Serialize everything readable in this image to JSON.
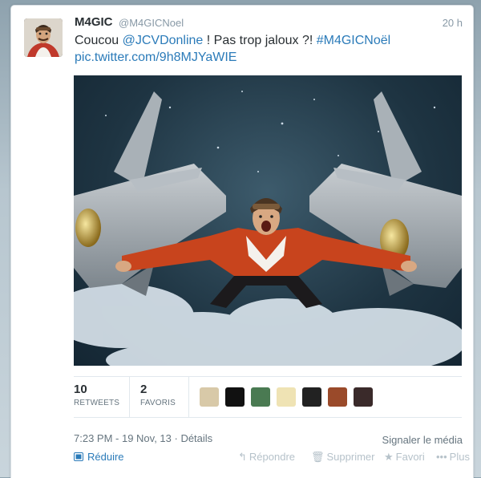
{
  "tweet": {
    "name": "M4GIC",
    "handle": "@M4GICNoel",
    "time": "20 h",
    "text_before": "Coucou ",
    "mention": "@JCVDonline",
    "text_middle": " ! Pas trop jaloux ?! ",
    "hashtag": "#M4GICNoël",
    "pic_link": "pic.twitter.com/9h8MJYaWIE"
  },
  "stats": {
    "retweets_count": "10",
    "retweets_label": "RETWEETS",
    "favorites_count": "2",
    "favorites_label": "FAVORIS"
  },
  "favoriters": [
    {
      "name": "favoriter-avatar-1",
      "color": "#d8c9a8"
    },
    {
      "name": "favoriter-avatar-2",
      "color": "#111111"
    },
    {
      "name": "favoriter-avatar-3",
      "color": "#4a7a52"
    },
    {
      "name": "favoriter-avatar-4",
      "color": "#efe3b4"
    },
    {
      "name": "favoriter-avatar-5",
      "color": "#222222"
    },
    {
      "name": "favoriter-avatar-6",
      "color": "#9a4a2a"
    },
    {
      "name": "favoriter-avatar-7",
      "color": "#3a2a2a"
    }
  ],
  "meta": {
    "timestamp": "7:23 PM - 19 Nov, 13",
    "separator": " · ",
    "details": "Détails",
    "report_media": "Signaler le média"
  },
  "actions": {
    "collapse": "Réduire",
    "reply": "Répondre",
    "delete": "Supprimer",
    "favorite": "Favori",
    "more": "Plus"
  },
  "colors": {
    "link": "#2b7bb9",
    "muted": "#8899a6",
    "disabled": "#b6c2ca"
  }
}
